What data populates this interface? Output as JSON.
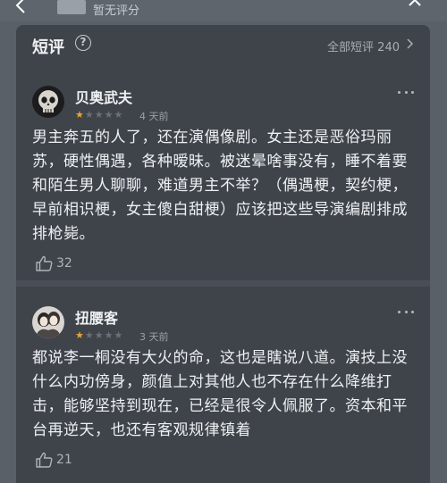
{
  "topbar": {
    "rating_text": "暂无评分"
  },
  "section": {
    "title": "短评",
    "all_link": "全部短评 240"
  },
  "reviews": [
    {
      "username": "贝奥武夫",
      "stars": 1,
      "time": "4 天前",
      "content": "男主奔五的人了，还在演偶像剧。女主还是恶俗玛丽苏，硬性偶遇，各种暧昧。被迷晕啥事没有，睡不着要和陌生男人聊聊，难道男主不举？（偶遇梗，契约梗，早前相识梗，女主傻白甜梗）应该把这些导演编剧排成排枪毙。",
      "likes": "32"
    },
    {
      "username": "扭腰客",
      "stars": 1,
      "time": "3 天前",
      "content": "都说李一桐没有大火的命，这也是瞎说八道。演技上没什么内功傍身，颜值上对其他人也不存在什么降维打击，能够坚持到现在，已经是很令人佩服了。资本和平台再逆天，也还有客观规律镇着",
      "likes": "21"
    }
  ],
  "colors": {
    "background": "#5a6068",
    "card": "#3f444b",
    "star_filled": "#e8a33c",
    "star_empty": "#6c7178"
  }
}
